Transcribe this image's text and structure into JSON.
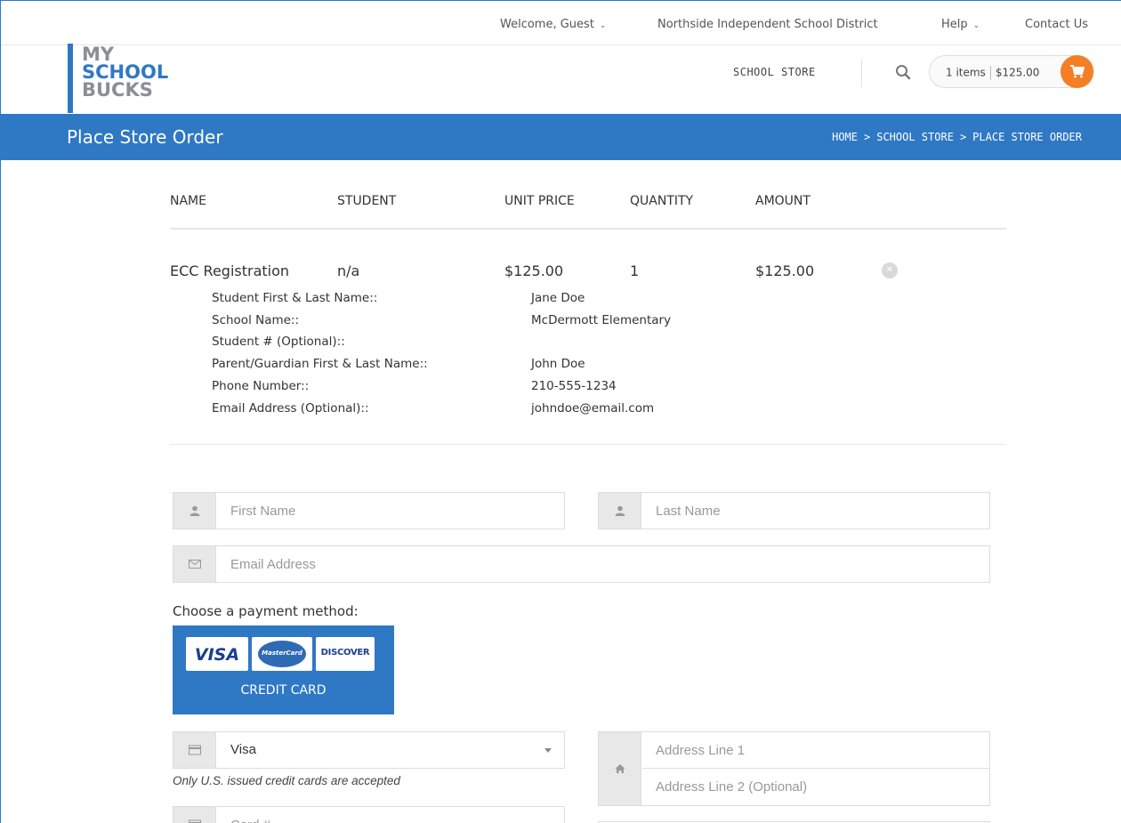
{
  "topbar": {
    "welcome": "Welcome, Guest",
    "district": "Northside Independent School District",
    "help": "Help",
    "contact": "Contact Us"
  },
  "logo": {
    "line1": "MY",
    "line2": "SCHOOL",
    "line3": "BUCKS"
  },
  "nav": {
    "store": "SCHOOL STORE"
  },
  "cart": {
    "items": "1 items",
    "total": "$125.00"
  },
  "page": {
    "title": "Place Store Order"
  },
  "breadcrumb": {
    "home": "HOME",
    "store": "SCHOOL STORE",
    "current": "PLACE STORE ORDER",
    "sep": ">"
  },
  "table": {
    "headers": [
      "NAME",
      "STUDENT",
      "UNIT PRICE",
      "QUANTITY",
      "AMOUNT"
    ],
    "row": {
      "name": "ECC Registration",
      "student": "n/a",
      "unit_price": "$125.00",
      "quantity": "1",
      "amount": "$125.00"
    },
    "details": [
      {
        "label": "Student First & Last Name::",
        "value": "Jane Doe"
      },
      {
        "label": "School Name::",
        "value": "McDermott Elementary"
      },
      {
        "label": "Student # (Optional)::",
        "value": ""
      },
      {
        "label": "Parent/Guardian First & Last Name::",
        "value": "John Doe"
      },
      {
        "label": "Phone Number::",
        "value": "210-555-1234"
      },
      {
        "label": "Email Address (Optional)::",
        "value": "johndoe@email.com"
      }
    ]
  },
  "form": {
    "first_name_placeholder": "First Name",
    "last_name_placeholder": "Last Name",
    "email_placeholder": "Email Address",
    "payment_label": "Choose a payment method:",
    "credit_card_label": "CREDIT CARD",
    "card_brands": [
      "VISA",
      "MasterCard",
      "DISCOVER"
    ],
    "card_type_value": "Visa",
    "card_note": "Only U.S. issued credit cards are accepted",
    "address1_placeholder": "Address Line 1",
    "address2_placeholder": "Address Line 2 (Optional)",
    "card_number_placeholder": "Card #"
  },
  "colors": {
    "brand_blue": "#2f78c4",
    "cart_orange": "#f47f24",
    "logo_gray": "#8a8f96"
  },
  "icons": [
    "chevron-down-icon",
    "search-icon",
    "cart-icon",
    "close-icon",
    "user-icon",
    "envelope-icon",
    "credit-card-icon",
    "home-icon"
  ]
}
